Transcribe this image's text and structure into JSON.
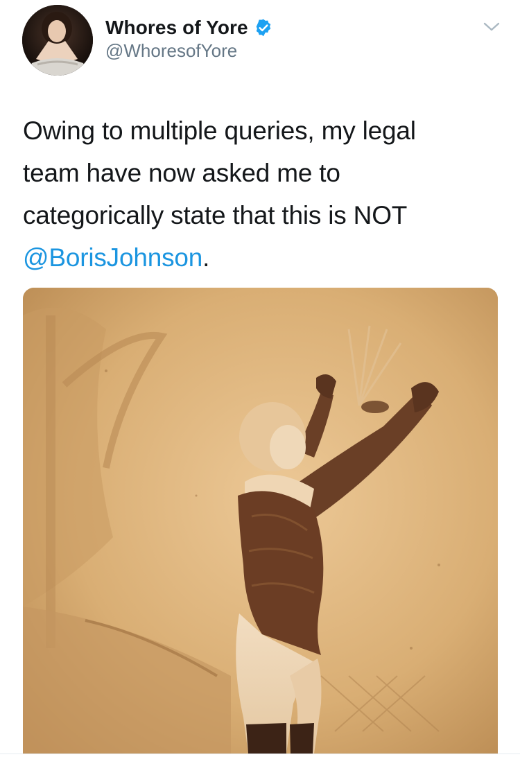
{
  "tweet": {
    "author": {
      "display_name": "Whores of Yore",
      "handle": "@WhoresofYore",
      "verified": true,
      "avatar_icon": "portrait-avatar"
    },
    "menu_icon": "chevron-down-icon",
    "text_lines": [
      "Owing to multiple queries, my legal",
      "team have now asked me to",
      "categorically state that this is NOT"
    ],
    "mention": "@BorisJohnson",
    "mention_suffix": ".",
    "media": {
      "kind": "photo",
      "tone": "sepia"
    }
  },
  "colors": {
    "text": "#14171a",
    "secondary": "#657786",
    "link": "#1b95e0",
    "verified": "#1da1f2",
    "sepia_base": "#d8b079"
  }
}
